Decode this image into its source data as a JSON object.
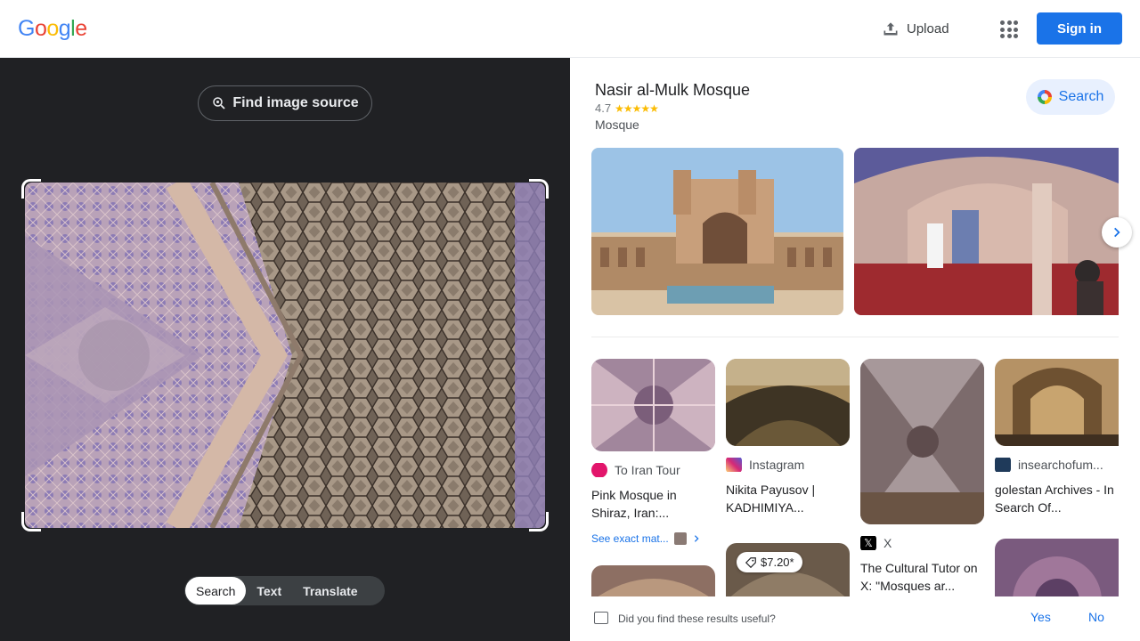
{
  "header": {
    "logo_letters": [
      "G",
      "o",
      "o",
      "g",
      "l",
      "e"
    ],
    "logo_colors": [
      "#4285f4",
      "#ea4335",
      "#fbbc04",
      "#4285f4",
      "#34a853",
      "#ea4335"
    ],
    "upload_label": "Upload",
    "signin_label": "Sign in"
  },
  "left_panel": {
    "find_source_label": "Find image source",
    "modes": [
      "Search",
      "Text",
      "Translate"
    ],
    "active_mode": "Search"
  },
  "knowledge_panel": {
    "title": "Nasir al-Mulk Mosque",
    "rating": "4.7",
    "stars": "★★★★★",
    "type": "Mosque",
    "search_label": "Search"
  },
  "results": [
    {
      "source": "To Iran Tour",
      "source_icon": "to-iran-tour-icon",
      "title": "Pink Mosque in Shiraz, Iran:...",
      "exact_matches_label": "See exact mat..."
    },
    {
      "source": "Instagram",
      "source_icon": "instagram-icon",
      "title": "Nikita Payusov | KADHIMIYA..."
    },
    {
      "source": "X",
      "source_icon": "x-icon",
      "title": "The Cultural Tutor on X: \"Mosques ar..."
    },
    {
      "source": "insearchofum...",
      "source_icon": "insearchofum-icon",
      "title": "golestan Archives - In Search Of..."
    }
  ],
  "price_badge": "$7.20*",
  "feedback": {
    "question": "Did you find these results useful?",
    "yes_label": "Yes",
    "no_label": "No"
  }
}
